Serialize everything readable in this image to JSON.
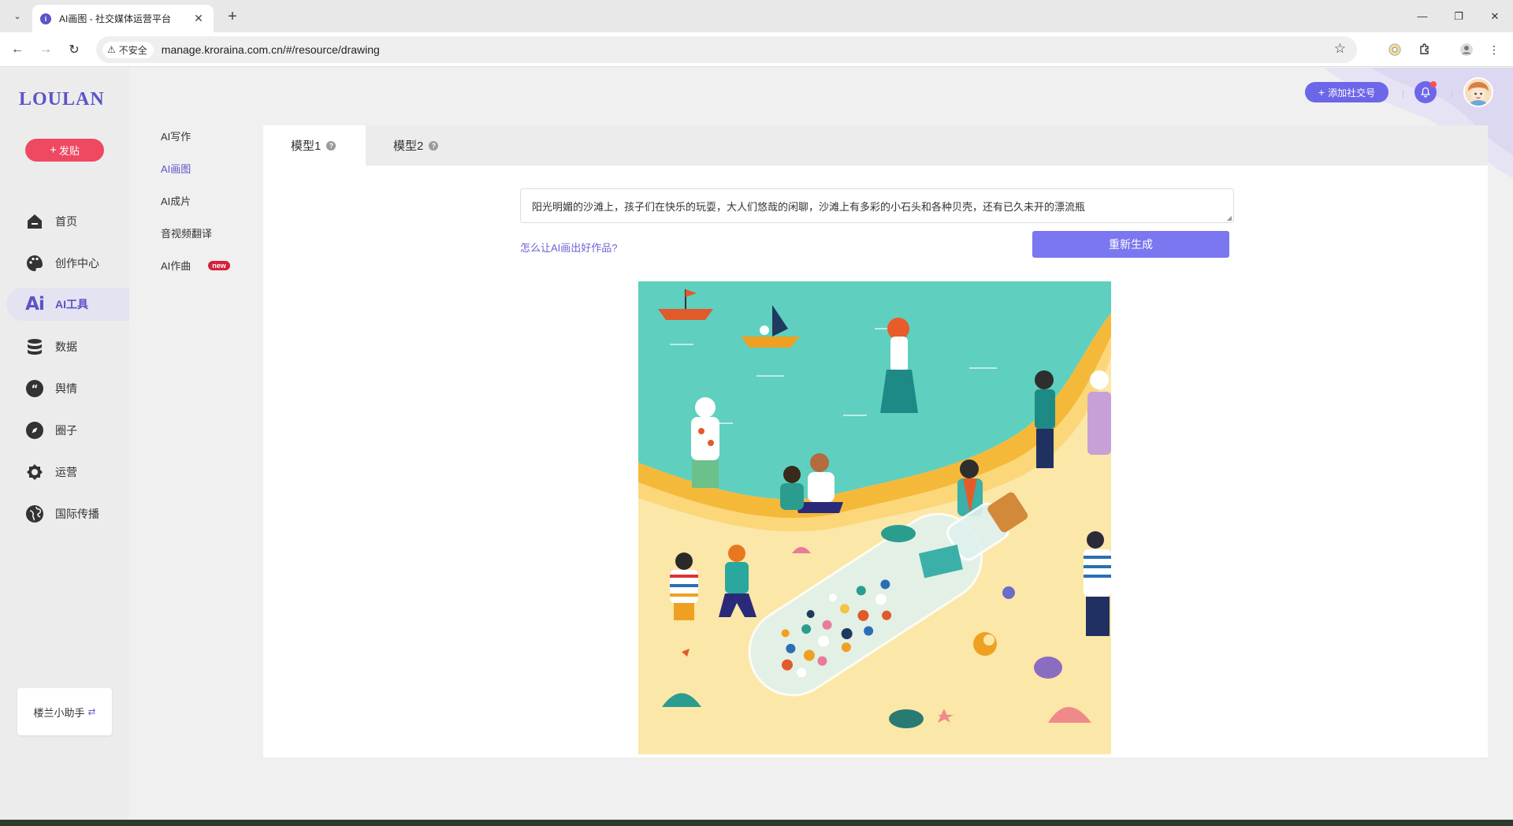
{
  "browser": {
    "tab_title": "AI画图 - 社交媒体运营平台",
    "security_label": "不安全",
    "url": "manage.kroraina.com.cn/#/resource/drawing"
  },
  "app": {
    "logo": "LOULAN",
    "post_button": "发贴",
    "nav": [
      {
        "label": "首页",
        "icon": "home-icon"
      },
      {
        "label": "创作中心",
        "icon": "palette-icon"
      },
      {
        "label": "AI工具",
        "icon": "ai-icon",
        "active": true
      },
      {
        "label": "数据",
        "icon": "database-icon"
      },
      {
        "label": "舆情",
        "icon": "quote-icon"
      },
      {
        "label": "圈子",
        "icon": "compass-icon"
      },
      {
        "label": "运营",
        "icon": "operations-icon"
      },
      {
        "label": "国际传播",
        "icon": "globe-icon"
      }
    ],
    "helper_label": "楼兰小助手",
    "subnav": [
      {
        "label": "AI写作"
      },
      {
        "label": "AI画图",
        "active": true
      },
      {
        "label": "AI成片"
      },
      {
        "label": "音视频翻译"
      },
      {
        "label": "AI作曲",
        "badge": "new"
      }
    ],
    "header": {
      "add_social_label": "添加社交号"
    },
    "model_tabs": [
      {
        "label": "模型1",
        "active": true
      },
      {
        "label": "模型2"
      }
    ],
    "prompt_text": "阳光明媚的沙滩上，孩子们在快乐的玩耍，大人们悠哉的闲聊，沙滩上有多彩的小石头和各种贝壳，还有已久未开的漂流瓶",
    "help_link": "怎么让AI画出好作品?",
    "regenerate_button": "重新生成"
  },
  "colors": {
    "brand": "#5a54c6",
    "post_button": "#ee4961",
    "regenerate_button": "#7b77f0",
    "badge_new": "#d6213a"
  }
}
